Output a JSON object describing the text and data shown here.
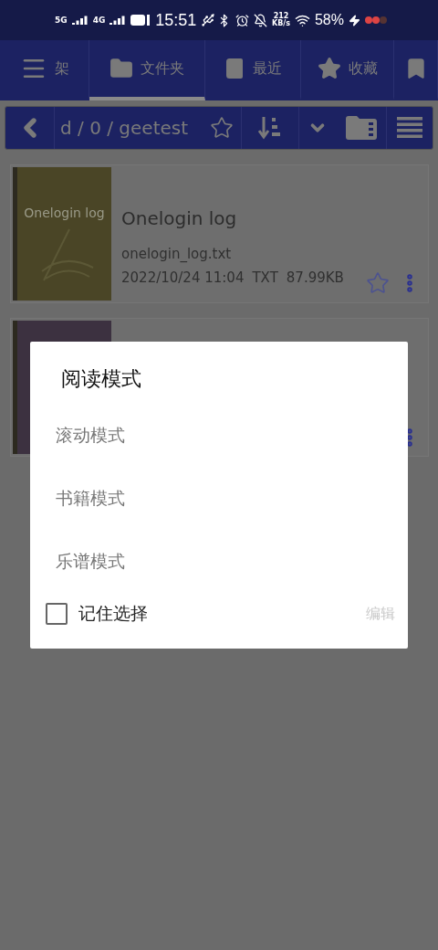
{
  "status_bar": {
    "network_1": "5G",
    "network_2": "4G",
    "time": "15:51",
    "speed": "212",
    "speed_unit": "KB/s",
    "battery": "58%"
  },
  "tabs": [
    {
      "label": "架",
      "selected": false
    },
    {
      "label": "文件夹",
      "selected": true
    },
    {
      "label": "最近",
      "selected": false
    },
    {
      "label": "收藏",
      "selected": false
    }
  ],
  "path_bar": {
    "path": "d / 0 / geetest",
    "favorite": false
  },
  "books": [
    {
      "cover_title": "Onelogin log",
      "title": "Onelogin log",
      "filename": "onelogin_log.txt",
      "date": "2022/10/24 11:04",
      "type": "TXT",
      "size": "87.99KB",
      "favorite": false,
      "color": "#4a4526"
    },
    {
      "color": "#3c3140"
    }
  ],
  "dialog": {
    "title": "阅读模式",
    "options": [
      {
        "label": "滚动模式",
        "selected": false
      },
      {
        "label": "书籍模式",
        "selected": false
      },
      {
        "label": "乐谱模式",
        "selected": false
      }
    ],
    "remember": {
      "label": "记住选择",
      "checked": false
    },
    "edit": {
      "label": "编辑",
      "disabled": true
    }
  }
}
